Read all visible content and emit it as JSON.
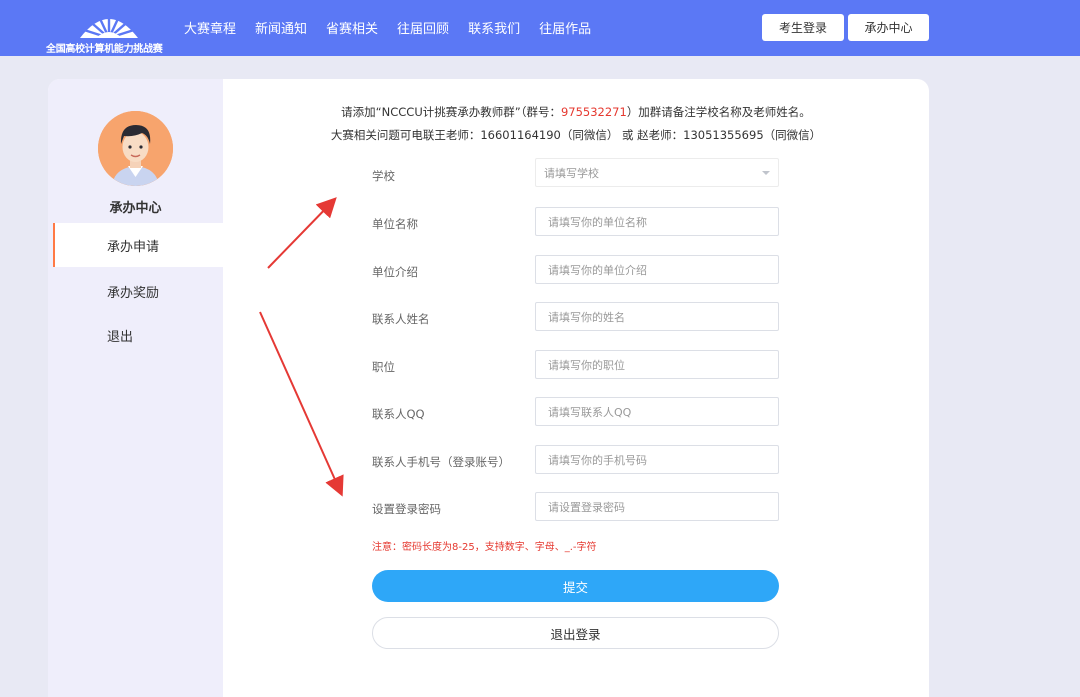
{
  "header": {
    "logo_text": "全国高校计算机能力挑战赛",
    "nav": [
      "大赛章程",
      "新闻通知",
      "省赛相关",
      "往届回顾",
      "联系我们",
      "往届作品"
    ],
    "student_login": "考生登录",
    "host_center": "承办中心"
  },
  "sidebar": {
    "title": "承办中心",
    "items": [
      "承办申请",
      "承办奖励",
      "退出"
    ]
  },
  "notice": {
    "line1_prefix": "请添加“NCCCU计挑赛承办教师群”（群号：",
    "group_number": "975532271",
    "line1_suffix": "）加群请备注学校名称及老师姓名。",
    "line2": "大赛相关问题可电联王老师：16601164190（同微信） 或 赵老师：13051355695（同微信）"
  },
  "form": {
    "fields": [
      {
        "label": "学校",
        "placeholder": "请填写学校"
      },
      {
        "label": "单位名称",
        "placeholder": "请填写你的单位名称"
      },
      {
        "label": "单位介绍",
        "placeholder": "请填写你的单位介绍"
      },
      {
        "label": "联系人姓名",
        "placeholder": "请填写你的姓名"
      },
      {
        "label": "职位",
        "placeholder": "请填写你的职位"
      },
      {
        "label": "联系人QQ",
        "placeholder": "请填写联系人QQ"
      },
      {
        "label": "联系人手机号（登录账号）",
        "placeholder": "请填写你的手机号码"
      },
      {
        "label": "设置登录密码",
        "placeholder": "请设置登录密码"
      }
    ],
    "warning": "注意：密码长度为8-25，支持数字、字母、_.-字符",
    "submit": "提交",
    "logout": "退出登录"
  },
  "colors": {
    "header_bg": "#5b78f5",
    "submit_bg": "#2ea7f8",
    "accent_red": "#e5382f",
    "active_marker": "#ff7a45"
  }
}
